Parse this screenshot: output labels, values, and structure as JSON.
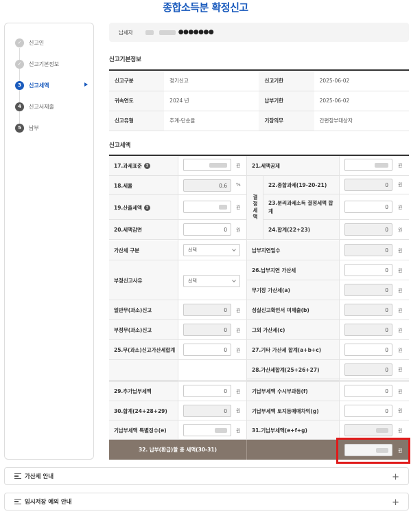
{
  "page_title": "종합소득분 확정신고",
  "steps": [
    {
      "num": "✓",
      "label": "신고인",
      "state": "done"
    },
    {
      "num": "✓",
      "label": "신고기본정보",
      "state": "done"
    },
    {
      "num": "3",
      "label": "신고세액",
      "state": "current"
    },
    {
      "num": "4",
      "label": "신고서제출",
      "state": "todo"
    },
    {
      "num": "5",
      "label": "납부",
      "state": "todo"
    }
  ],
  "payer": {
    "label": "납세자",
    "masked": "●●●●●●●"
  },
  "basic_info": {
    "title": "신고기본정보",
    "rows": [
      {
        "l1": "신고구분",
        "v1": "정기신고",
        "l2": "신고기한",
        "v2": "2025-06-02"
      },
      {
        "l1": "귀속연도",
        "v1": "2024 년",
        "l2": "납부기한",
        "v2": "2025-06-02"
      },
      {
        "l1": "신고유형",
        "v1": "추계-단순율",
        "l2": "기장의무",
        "v2": "간편장부대상자"
      }
    ]
  },
  "tax": {
    "title": "신고세액",
    "unit": "원",
    "pct": "%",
    "f17": "17.과세표준",
    "f18": "18.세율",
    "f18_value": "0.6",
    "f19": "19.산출세액",
    "f20": "20.세액감면",
    "f20_value": "0",
    "f21": "21.세액공제",
    "group_label": "결정세액",
    "f22": "22.종합과세(19-20-21)",
    "f22_value": "0",
    "f23": "23.분리과세소득 결정세액 합계",
    "f23_value": "0",
    "f24": "24.합계(22+23)",
    "f24_value": "0",
    "penalty_type": "가산세 구분",
    "select_placeholder": "선택",
    "wrong_reason": "부정신고사유",
    "general_under": "일반무(과소)신고",
    "general_under_value": "0",
    "fraud_under": "부정무(과소)신고",
    "fraud_under_value": "0",
    "f25": "25.무(과소)신고가산세합계",
    "f25_value": "0",
    "late_days": "납부지연일수",
    "late_days_value": "0",
    "f26": "26.납부지연 가산세",
    "f26_value": "0",
    "no_book": "무기장 가산세(a)",
    "no_book_value": "0",
    "unsincere": "성실신고확인서 미제출(b)",
    "unsincere_value": "0",
    "other": "그외 가산세(c)",
    "other_value": "0",
    "f27": "27.기타 가산세 합계(a+b+c)",
    "f27_value": "0",
    "f28": "28.가산세합계(25+26+27)",
    "f28_value": "0",
    "f29": "29.추가납부세액",
    "f29_value": "0",
    "f30": "30.합계(24+28+29)",
    "f30_value": "0",
    "special": "기납부세액 특별징수(e)",
    "paid_f": "기납부세액 수시부과등(f)",
    "paid_f_value": "0",
    "paid_g": "기납부세액 토지등매매차익(g)",
    "paid_g_value": "0",
    "f31": "31.기납부세액(e+f+g)",
    "f32": "32. 납부(환급)할 총 세액(30-31)"
  },
  "accordions": [
    {
      "label": "가산세 안내"
    },
    {
      "label": "임시저장 예외 안내"
    }
  ],
  "colors": {
    "primary": "#1a5bbd",
    "footer": "#84766b",
    "highlight": "#e01b1b"
  }
}
